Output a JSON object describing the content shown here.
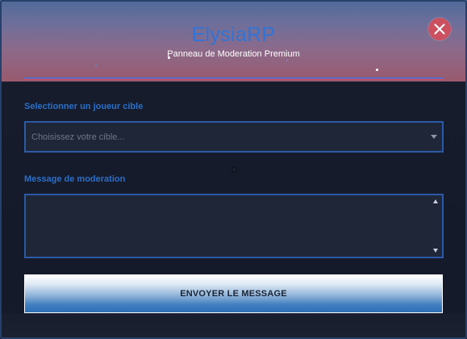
{
  "app": {
    "title": "ElysiaRP",
    "subtitle": "Panneau de Moderation Premium"
  },
  "target": {
    "label": "Selectionner un joueur cible",
    "placeholder": "Choisissez votre cible..."
  },
  "message": {
    "label": "Message de moderation",
    "value": ""
  },
  "actions": {
    "send_label": "ENVOYER LE MESSAGE"
  },
  "colors": {
    "accent": "#2f74d8",
    "close": "#cc5060",
    "border": "#2b5aa6",
    "background": "#151b2c"
  },
  "icons": {
    "close": "close-icon",
    "dropdown": "chevron-down-icon"
  }
}
